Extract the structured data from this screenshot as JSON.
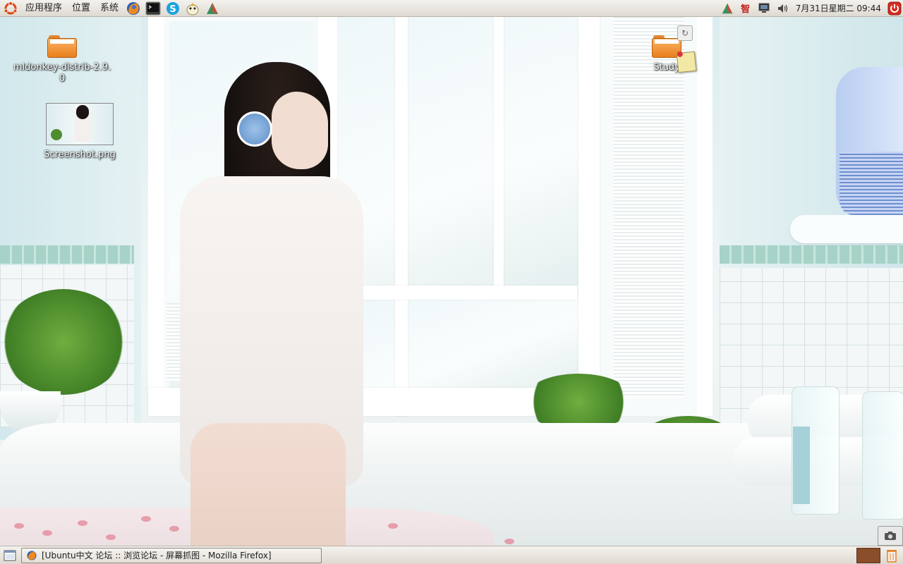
{
  "top_panel": {
    "menus": [
      {
        "id": "applications",
        "label": "应用程序"
      },
      {
        "id": "places",
        "label": "位置"
      },
      {
        "id": "system",
        "label": "系统"
      }
    ],
    "launchers": [
      "firefox-icon",
      "terminal-icon",
      "skype-icon",
      "pidgin-icon",
      "network-icon"
    ],
    "tray_icons": [
      "network-tray-icon",
      "ime-icon",
      "monitor-icon",
      "volume-icon"
    ],
    "ime_glyph": "智",
    "clock": "7月31日星期二 09:44",
    "power_icon": "power-icon"
  },
  "desktop": {
    "icons": [
      {
        "name": "mldonkey-folder",
        "label": "mldonkey-distrib-2.9.0",
        "type": "folder"
      },
      {
        "name": "screenshot-file",
        "label": "Screenshot.png",
        "type": "image"
      },
      {
        "name": "study-folder",
        "label": "Study",
        "type": "folder"
      }
    ]
  },
  "bottom_panel": {
    "show_desktop_icon": "show-desktop-icon",
    "tasks": [
      {
        "icon": "firefox-icon",
        "label": "[Ubuntu中文 论坛 :: 浏览论坛 -  屏幕抓图 - Mozilla Firefox]"
      }
    ],
    "workspace_color": "#8a4e2a",
    "trash_icon": "trash-icon"
  },
  "colors": {
    "panel_top": "#f4f2ee",
    "panel_bottom": "#dedad2",
    "ubuntu_orange": "#e95420",
    "folder_orange": "#f09a3e"
  }
}
